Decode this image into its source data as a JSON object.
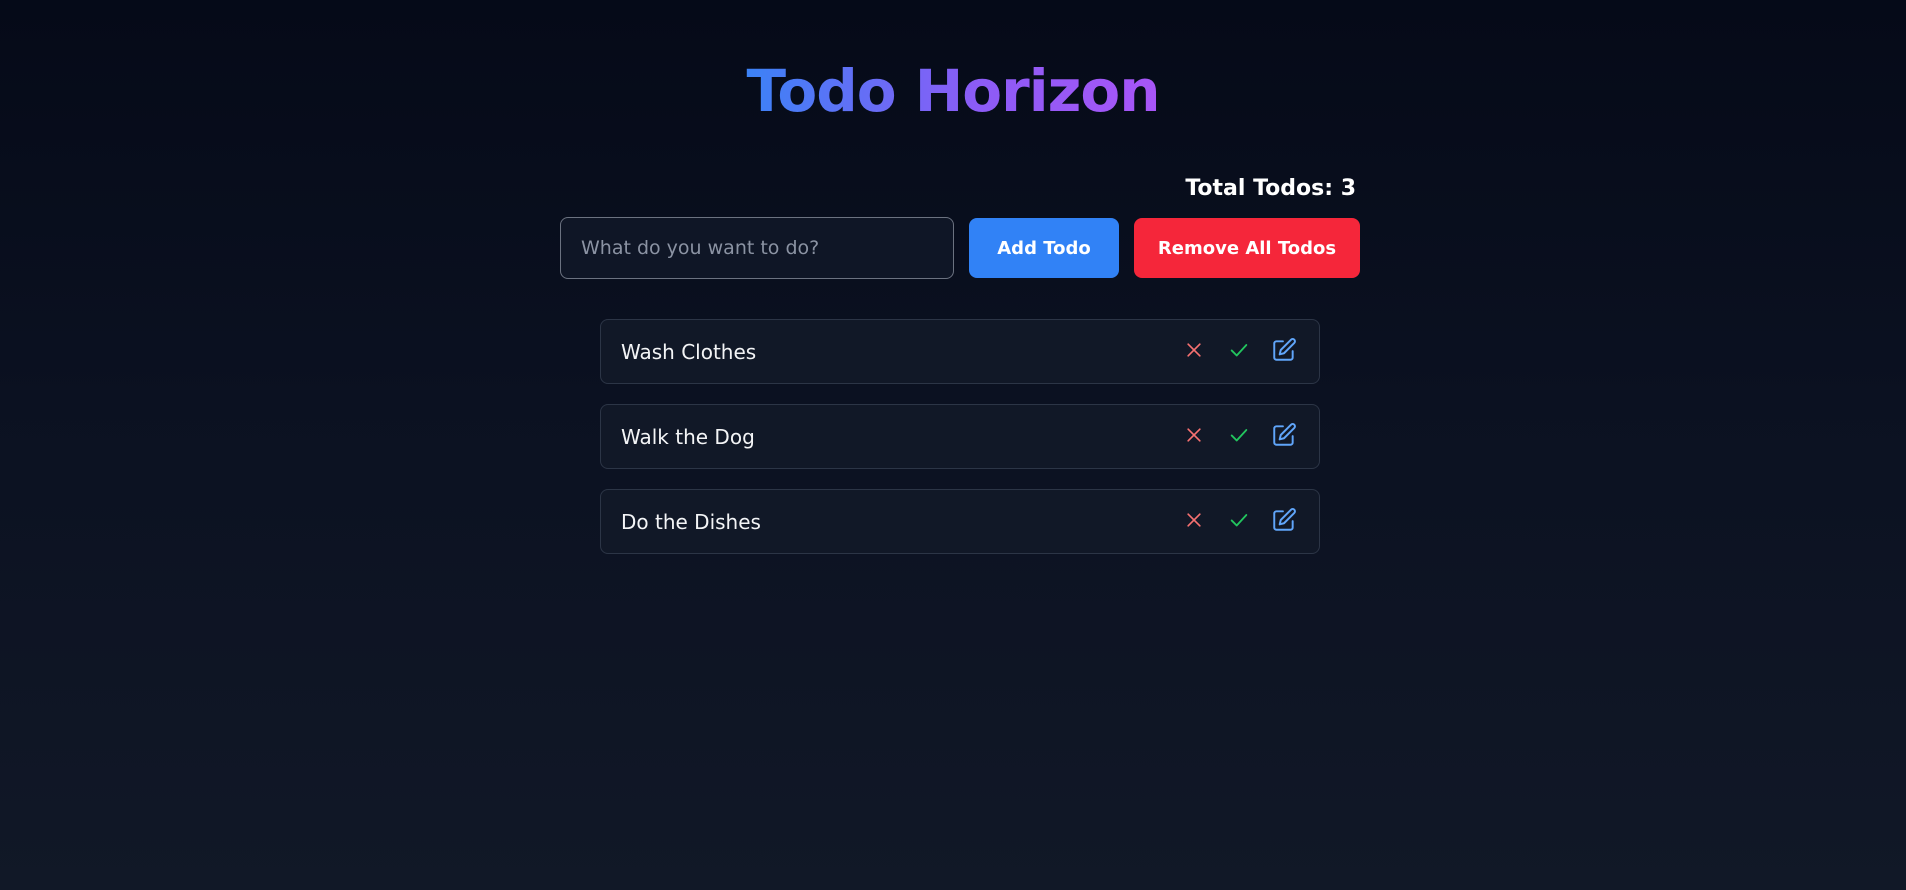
{
  "app": {
    "title": "Todo Horizon"
  },
  "stats": {
    "total_label": "Total Todos: 3"
  },
  "form": {
    "input_value": "",
    "input_placeholder": "What do you want to do?",
    "add_label": "Add Todo",
    "remove_all_label": "Remove All Todos"
  },
  "todos": [
    {
      "text": "Wash Clothes"
    },
    {
      "text": "Walk the Dog"
    },
    {
      "text": "Do the Dishes"
    }
  ],
  "icons": {
    "delete": "x-icon",
    "complete": "check-icon",
    "edit": "edit-icon"
  },
  "colors": {
    "accent_blue": "#3182f6",
    "danger_red": "#f5263a",
    "delete_icon": "#f87171",
    "check_icon": "#22c55e",
    "edit_icon": "#60a5fa",
    "title_gradient_start": "#3b82f6",
    "title_gradient_end": "#a855f7"
  }
}
